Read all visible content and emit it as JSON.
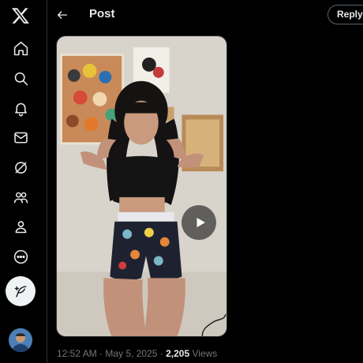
{
  "header": {
    "title": "Post",
    "reply_label": "Reply"
  },
  "nav": {
    "icons": [
      "x-logo-icon",
      "home-icon",
      "explore-icon",
      "notifications-icon",
      "messages-icon",
      "grok-icon",
      "communities-icon",
      "profile-icon",
      "more-icon",
      "compose-post-icon"
    ]
  },
  "post": {
    "time": "12:52 AM",
    "separator": "·",
    "date": "May 5, 2025",
    "views_count": "2,205",
    "views_label": "Views"
  },
  "colors": {
    "background": "#000000",
    "text": "#e7e9ea",
    "muted": "#71767b",
    "border": "#2f3336"
  }
}
